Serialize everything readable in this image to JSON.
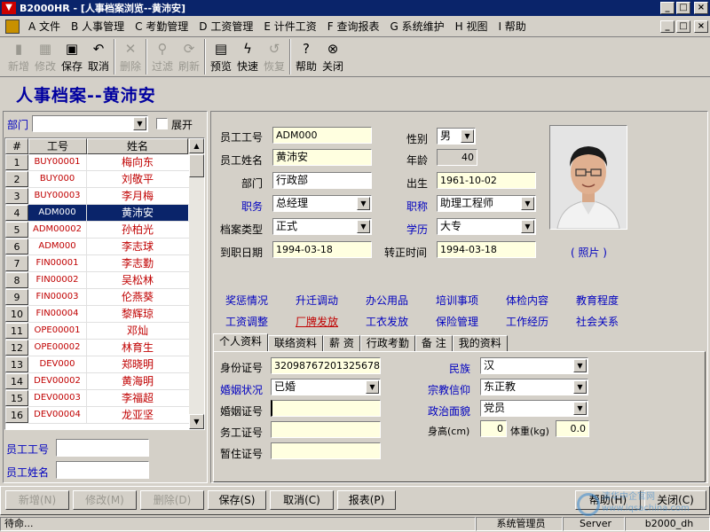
{
  "window": {
    "title": "B2000HR - [人事档案浏览--黄沛安]",
    "min": "_",
    "max": "□",
    "close": "×"
  },
  "menu": [
    "A 文件",
    "B 人事管理",
    "C 考勤管理",
    "D 工资管理",
    "E 计件工资",
    "F 查询报表",
    "G 系统维护",
    "H 视图",
    "I 帮助"
  ],
  "toolbar": [
    {
      "label": "新增",
      "icon": "▮",
      "enabled": false
    },
    {
      "label": "修改",
      "icon": "▦",
      "enabled": false
    },
    {
      "label": "保存",
      "icon": "▣",
      "enabled": true
    },
    {
      "label": "取消",
      "icon": "↶",
      "enabled": true
    },
    {
      "label": "删除",
      "icon": "✕",
      "enabled": false
    },
    {
      "label": "过滤",
      "icon": "⚲",
      "enabled": false
    },
    {
      "label": "刷新",
      "icon": "⟳",
      "enabled": false
    },
    {
      "label": "预览",
      "icon": "▤",
      "enabled": true
    },
    {
      "label": "快速",
      "icon": "ϟ",
      "enabled": true
    },
    {
      "label": "恢复",
      "icon": "↺",
      "enabled": false
    },
    {
      "label": "帮助",
      "icon": "?",
      "enabled": true
    },
    {
      "label": "关闭",
      "icon": "⊗",
      "enabled": true
    }
  ],
  "page_title": "人事档案--黄沛安",
  "filter": {
    "dept_label": "部门",
    "dept_value": "",
    "expand_label": "展开"
  },
  "grid": {
    "headers": [
      "#",
      "工号",
      "姓名"
    ],
    "rows": [
      {
        "n": "1",
        "id": "BUY00001",
        "name": "梅向东"
      },
      {
        "n": "2",
        "id": "BUY000",
        "name": "刘敬平"
      },
      {
        "n": "3",
        "id": "BUY00003",
        "name": "李月梅"
      },
      {
        "n": "4",
        "id": "ADM000",
        "name": "黄沛安",
        "selected": true
      },
      {
        "n": "5",
        "id": "ADM00002",
        "name": "孙柏光"
      },
      {
        "n": "6",
        "id": "ADM000",
        "name": "李志球"
      },
      {
        "n": "7",
        "id": "FIN00001",
        "name": "李志勤"
      },
      {
        "n": "8",
        "id": "FIN00002",
        "name": "吴松林"
      },
      {
        "n": "9",
        "id": "FIN00003",
        "name": "伦燕葵"
      },
      {
        "n": "10",
        "id": "FIN00004",
        "name": "黎辉琼"
      },
      {
        "n": "11",
        "id": "OPE00001",
        "name": "邓灿"
      },
      {
        "n": "12",
        "id": "OPE00002",
        "name": "林育生"
      },
      {
        "n": "13",
        "id": "DEV000",
        "name": "郑晓明"
      },
      {
        "n": "14",
        "id": "DEV00002",
        "name": "黄海明"
      },
      {
        "n": "15",
        "id": "DEV00003",
        "name": "李福超"
      },
      {
        "n": "16",
        "id": "DEV00004",
        "name": "龙亚坚"
      }
    ]
  },
  "search": {
    "id_label": "员工工号",
    "name_label": "员工姓名"
  },
  "form": {
    "emp_id_label": "员工工号",
    "emp_id": "ADM000",
    "emp_name_label": "员工姓名",
    "emp_name": "黄沛安",
    "dept_label": "部门",
    "dept": "行政部",
    "post_label": "职务",
    "post": "总经理",
    "type_label": "档案类型",
    "type": "正式",
    "join_label": "到职日期",
    "join": "1994-03-18",
    "sex_label": "性别",
    "sex": "男",
    "age_label": "年龄",
    "age": "40",
    "birth_label": "出生",
    "birth": "1961-10-02",
    "title_label": "职称",
    "title": "助理工程师",
    "edu_label": "学历",
    "edu": "大专",
    "regular_label": "转正时间",
    "regular": "1994-03-18",
    "photo_label": "( 照片 )"
  },
  "links_row1": [
    "奖惩情况",
    "升迁调动",
    "办公用品",
    "培训事项",
    "体检内容",
    "教育程度"
  ],
  "links_row2": [
    "工资调整",
    "厂牌发放",
    "工衣发放",
    "保险管理",
    "工作经历",
    "社会关系"
  ],
  "tabs": [
    "个人资料",
    "联络资料",
    "薪 资",
    "行政考勤",
    "备 注",
    "我的资料"
  ],
  "personal": {
    "idcard_label": "身份证号",
    "idcard": "32098767201325678",
    "marital_label": "婚姻状况",
    "marital": "已婚",
    "marriage_cert_label": "婚姻证号",
    "marriage_cert": "",
    "work_cert_label": "务工证号",
    "work_cert": "",
    "temp_cert_label": "暂住证号",
    "temp_cert": "",
    "nation_label": "民族",
    "nation": "汉",
    "religion_label": "宗教信仰",
    "religion": "东正教",
    "politics_label": "政治面貌",
    "politics": "党员",
    "height_label": "身高(cm)",
    "height": "0",
    "weight_label": "体重(kg)",
    "weight": "0.0"
  },
  "bottom_buttons": [
    {
      "label": "新增(N)",
      "enabled": false
    },
    {
      "label": "修改(M)",
      "enabled": false
    },
    {
      "label": "删除(D)",
      "enabled": false
    },
    {
      "label": "保存(S)",
      "enabled": true
    },
    {
      "label": "取消(C)",
      "enabled": true
    },
    {
      "label": "报表(P)",
      "enabled": true
    },
    {
      "label": "帮助(H)",
      "enabled": true
    },
    {
      "label": "关闭(C)",
      "enabled": true
    }
  ],
  "watermark": "清华中企官网 www.iqsachina.com",
  "status": {
    "text": "待命...",
    "user": "系统管理员",
    "server": "Server",
    "db": "b2000_dh"
  }
}
